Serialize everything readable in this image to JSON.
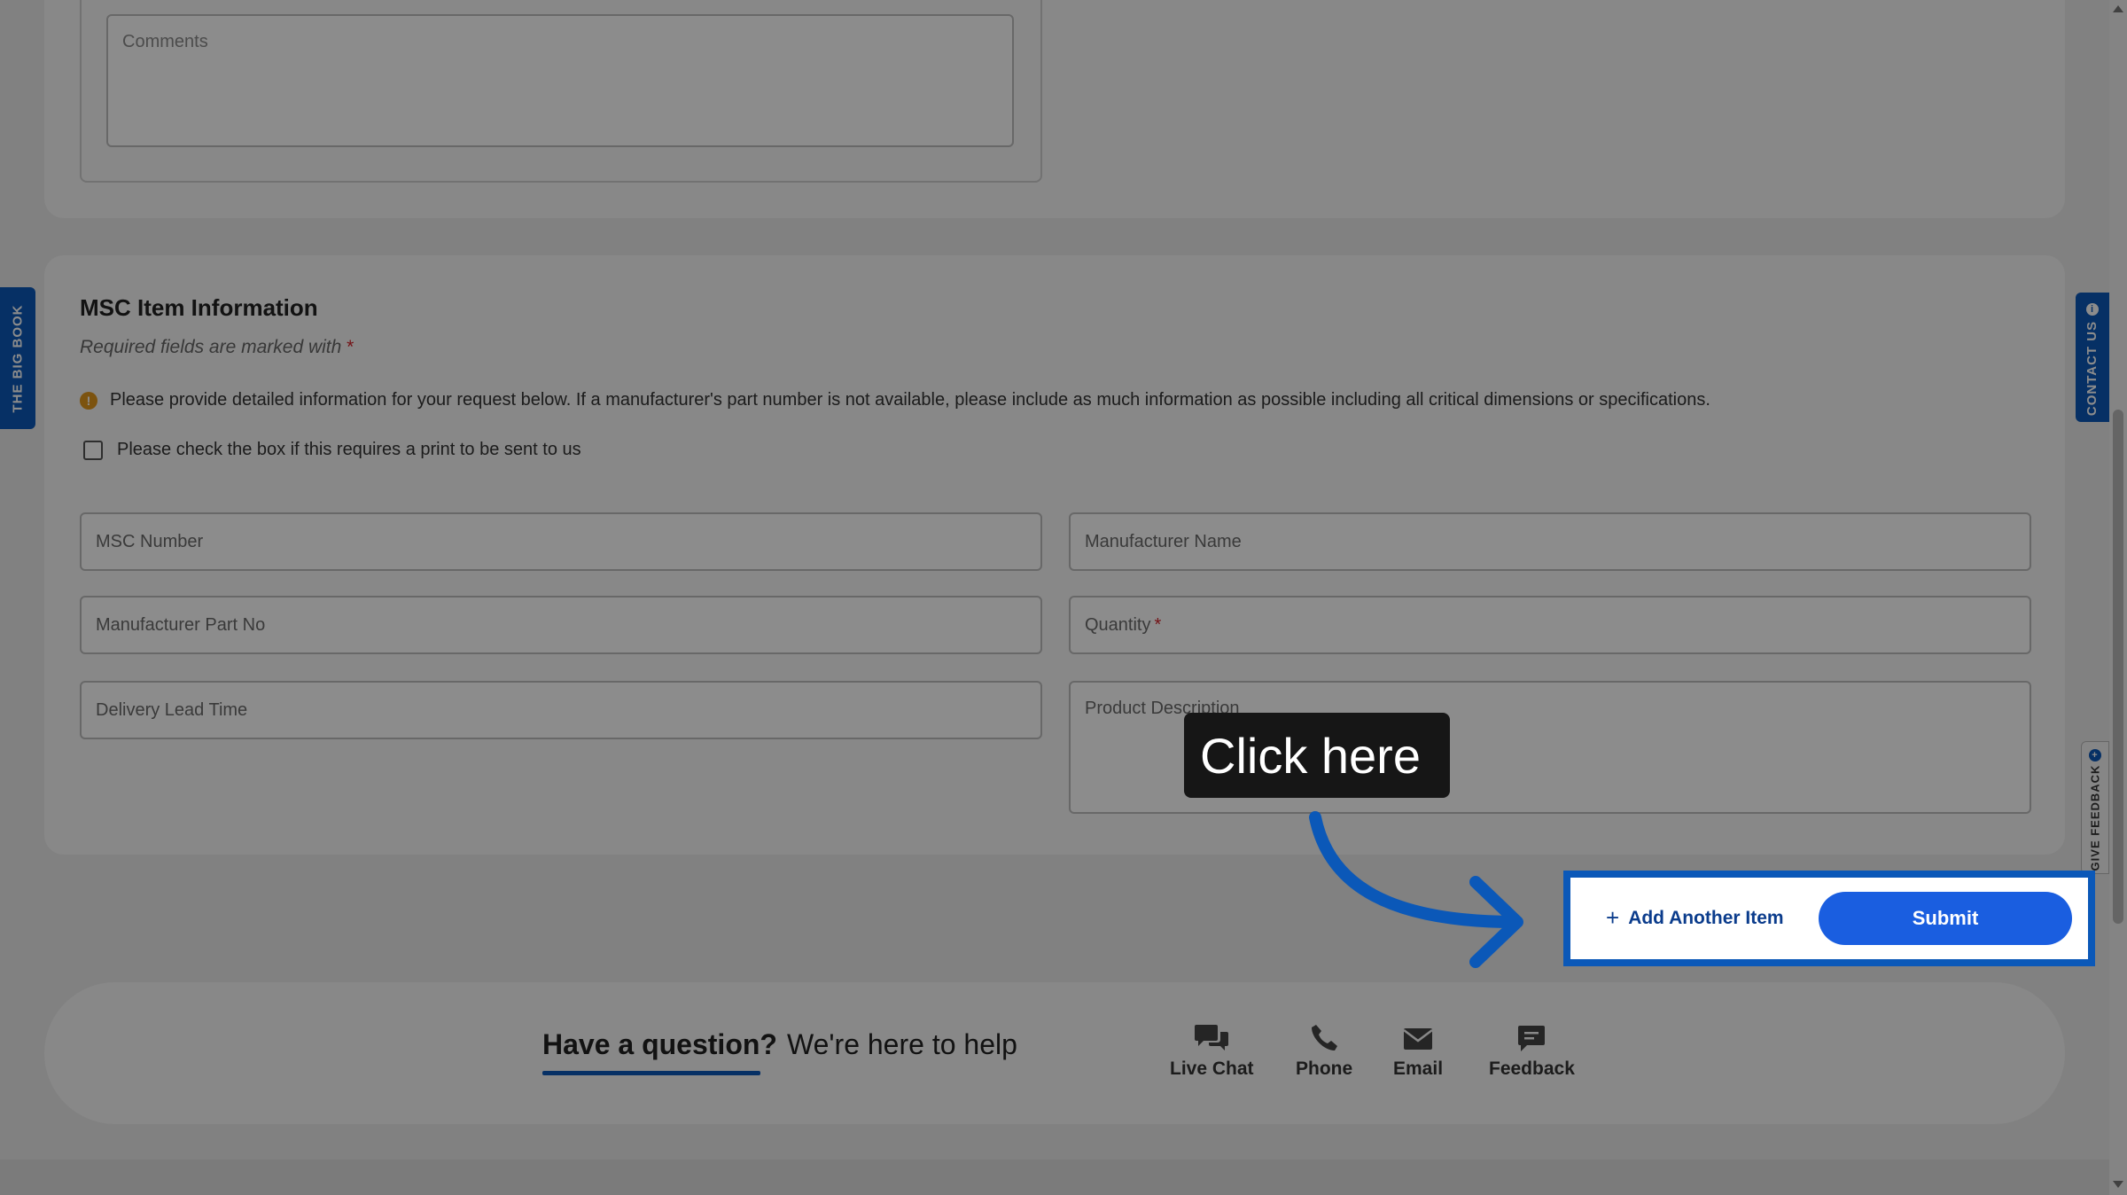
{
  "comments": {
    "placeholder": "Comments"
  },
  "item_section": {
    "title": "MSC Item Information",
    "required_note": "Required fields are marked with",
    "required_star": "*",
    "info_text": "Please provide detailed information for your request below. If a manufacturer's part number is not available, please include as much information as possible including all critical dimensions or specifications.",
    "print_checkbox_label": "Please check the box if this requires a print to be sent to us",
    "fields": {
      "msc_number": "MSC Number",
      "manufacturer_name": "Manufacturer Name",
      "manufacturer_part_no": "Manufacturer Part No",
      "quantity": "Quantity",
      "delivery_lead_time": "Delivery Lead Time",
      "product_description": "Product Description"
    }
  },
  "actions": {
    "add_item_label": "Add Another Item",
    "submit_label": "Submit"
  },
  "callout": {
    "text": "Click here"
  },
  "side_tabs": {
    "big_book": "THE BIG BOOK",
    "contact_us": "CONTACT US",
    "give_feedback": "GIVE FEEDBACK"
  },
  "footer": {
    "question": "Have a question?",
    "help": "We're here to help",
    "options": {
      "live_chat": "Live Chat",
      "phone": "Phone",
      "email": "Email",
      "feedback": "Feedback"
    }
  },
  "colors": {
    "brand_blue": "#0b58b8",
    "submit_blue": "#1a5ee0",
    "required_red": "#d4232a",
    "warning_orange": "#e2971c"
  }
}
